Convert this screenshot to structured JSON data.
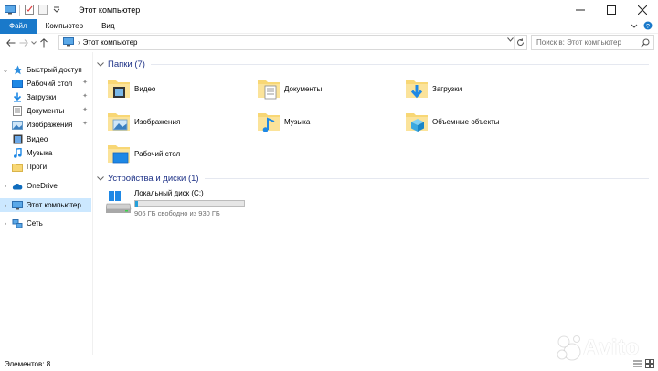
{
  "window": {
    "title": "Этот компьютер"
  },
  "ribbon": {
    "tabs": [
      {
        "label": "Файл"
      },
      {
        "label": "Компьютер"
      },
      {
        "label": "Вид"
      }
    ]
  },
  "address": {
    "path": "Этот компьютер",
    "search_placeholder": "Поиск в: Этот компьютер"
  },
  "nav": {
    "items": [
      {
        "label": "Быстрый доступ",
        "icon": "star-icon"
      },
      {
        "label": "Рабочий стол",
        "icon": "desktop-icon",
        "pinned": true
      },
      {
        "label": "Загрузки",
        "icon": "downloads-icon",
        "pinned": true
      },
      {
        "label": "Документы",
        "icon": "documents-icon",
        "pinned": true
      },
      {
        "label": "Изображения",
        "icon": "pictures-icon",
        "pinned": true
      },
      {
        "label": "Видео",
        "icon": "video-icon"
      },
      {
        "label": "Музыка",
        "icon": "music-icon"
      },
      {
        "label": "Проги",
        "icon": "folder-icon"
      },
      {
        "label": "OneDrive",
        "icon": "onedrive-icon"
      },
      {
        "label": "Этот компьютер",
        "icon": "computer-icon",
        "selected": true
      },
      {
        "label": "Сеть",
        "icon": "network-icon"
      }
    ]
  },
  "content": {
    "folders_header": "Папки (7)",
    "folders": [
      {
        "label": "Видео",
        "icon": "video-folder-icon"
      },
      {
        "label": "Документы",
        "icon": "documents-folder-icon"
      },
      {
        "label": "Загрузки",
        "icon": "downloads-folder-icon"
      },
      {
        "label": "Изображения",
        "icon": "pictures-folder-icon"
      },
      {
        "label": "Музыка",
        "icon": "music-folder-icon"
      },
      {
        "label": "Объемные объекты",
        "icon": "3d-objects-folder-icon"
      },
      {
        "label": "Рабочий стол",
        "icon": "desktop-folder-icon"
      }
    ],
    "devices_header": "Устройства и диски (1)",
    "drive": {
      "name": "Локальный диск (C:)",
      "free_text": "906 ГБ свободно из 930 ГБ",
      "used_fraction": 0.026
    }
  },
  "status": {
    "items_text": "Элементов: 8"
  },
  "watermark": {
    "text": "Avito"
  },
  "colors": {
    "accent": "#1979ca",
    "selection": "#cce8ff",
    "group_title": "#1e3287",
    "folder": "#f8d775",
    "drive_fill": "#26a0da"
  }
}
